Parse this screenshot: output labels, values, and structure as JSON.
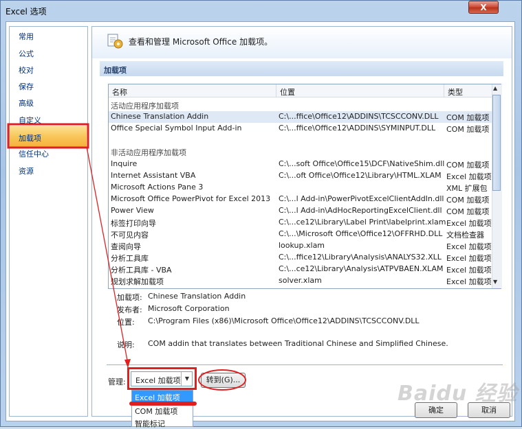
{
  "window": {
    "title": "Excel 选项",
    "close_label": "X"
  },
  "sidebar": {
    "items": [
      {
        "label": "常用"
      },
      {
        "label": "公式"
      },
      {
        "label": "校对"
      },
      {
        "label": "保存"
      },
      {
        "label": "高级"
      },
      {
        "label": "自定义"
      },
      {
        "label": "加载项"
      },
      {
        "label": "信任中心"
      },
      {
        "label": "资源"
      }
    ],
    "selected": "加载项"
  },
  "main": {
    "header_title": "查看和管理 Microsoft Office 加载项。",
    "section_title": "加载项",
    "list": {
      "columns": {
        "name": "名称",
        "location": "位置",
        "type": "类型"
      },
      "active_group": "活动应用程序加载项",
      "inactive_group": "非活动应用程序加载项",
      "active_rows": [
        {
          "name": "Chinese Translation Addin",
          "location": "C:\\...ffice\\Office12\\ADDINS\\TCSCCONV.DLL",
          "type": "COM 加载项"
        },
        {
          "name": "Office Special Symbol Input Add-in",
          "location": "C:\\...ffice\\Office12\\ADDINS\\SYMINPUT.DLL",
          "type": "COM 加载项"
        }
      ],
      "inactive_rows": [
        {
          "name": "Inquire",
          "location": "C:\\...soft Office\\Office15\\DCF\\NativeShim.dll",
          "type": "COM 加载项"
        },
        {
          "name": "Internet Assistant VBA",
          "location": "C:\\...oft Office\\Office12\\Library\\HTML.XLAM",
          "type": "Excel 加载项"
        },
        {
          "name": "Microsoft Actions Pane 3",
          "location": "",
          "type": "XML 扩展包"
        },
        {
          "name": "Microsoft Office PowerPivot for Excel 2013",
          "location": "C:\\...l Add-in\\PowerPivotExcelClientAddIn.dll",
          "type": "COM 加载项"
        },
        {
          "name": "Power View",
          "location": "C:\\...l Add-in\\AdHocReportingExcelClient.dll",
          "type": "COM 加载项"
        },
        {
          "name": "标签打印向导",
          "location": "C:\\...ce12\\Library\\Label Print\\labelprint.xlam",
          "type": "Excel 加载项"
        },
        {
          "name": "不可见内容",
          "location": "C:\\...\\Microsoft Office\\Office12\\OFFRHD.DLL",
          "type": "文档检查器"
        },
        {
          "name": "查阅向导",
          "location": "lookup.xlam",
          "type": "Excel 加载项"
        },
        {
          "name": "分析工具库",
          "location": "C:\\...ffice12\\Library\\Analysis\\ANALYS32.XLL",
          "type": "Excel 加载项"
        },
        {
          "name": "分析工具库 - VBA",
          "location": "C:\\...ce12\\Library\\Analysis\\ATPVBAEN.XLAM",
          "type": "Excel 加载项"
        },
        {
          "name": "规划求解加载项",
          "location": "solver.xlam",
          "type": "Excel 加载项"
        }
      ]
    },
    "details": {
      "addin_label": "加载项:",
      "addin_value": "Chinese Translation Addin",
      "publisher_label": "发布者:",
      "publisher_value": "Microsoft Corporation",
      "location_label": "位置:",
      "location_value": "C:\\Program Files (x86)\\Microsoft Office\\Office12\\ADDINS\\TCSCCONV.DLL",
      "desc_label": "说明:",
      "desc_value": "COM addin that translates between Traditional Chinese and Simplified Chinese."
    },
    "manage": {
      "label": "管理:",
      "selected": "Excel 加载项",
      "go_label": "转到(G)...",
      "options": [
        "Excel 加载项",
        "COM 加载项",
        "智能标记"
      ]
    }
  },
  "footer": {
    "ok_label": "确定",
    "cancel_label": "取消"
  },
  "watermark": "Baidu 经验"
}
